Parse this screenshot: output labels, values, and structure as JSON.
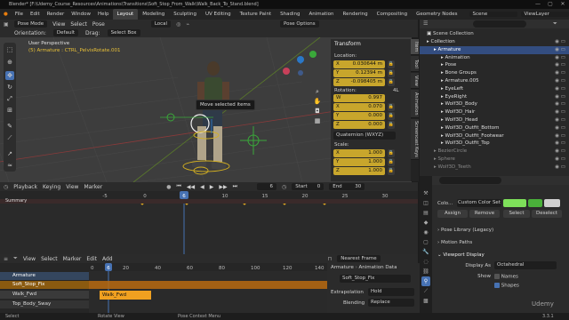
{
  "titlebar": {
    "text": "Blender* [F:\\Udemy_Course_Resources\\Animations\\Transitions\\Soft_Stop_From_Walk\\Walk_Back_To_Stand.blend]",
    "min": "—",
    "max": "▢",
    "close": "✕"
  },
  "menu": {
    "file": "File",
    "edit": "Edit",
    "render": "Render",
    "window": "Window",
    "help": "Help"
  },
  "workspaces": [
    "Layout",
    "Modeling",
    "Sculpting",
    "UV Editing",
    "Texture Paint",
    "Shading",
    "Animation",
    "Rendering",
    "Compositing",
    "Geometry Nodes"
  ],
  "scene": "Scene",
  "viewlayer": "ViewLayer",
  "viewport_header": {
    "mode": "Pose Mode",
    "view": "View",
    "select": "Select",
    "pose": "Pose",
    "orient_global": "Local",
    "orientation_label": "Orientation:",
    "orientation": "Default",
    "drag_label": "Drag:",
    "drag": "Select Box",
    "pose_options": "Pose Options"
  },
  "viewport": {
    "perspective": "User Perspective",
    "active": "(5) Armature : CTRL_PelvisRotate.001",
    "tooltip": "Move selected items"
  },
  "transform": {
    "title": "Transform",
    "location_label": "Location:",
    "loc": [
      "X",
      "Y",
      "Z"
    ],
    "loc_vals": [
      "0.030644 m",
      "0.12394 m",
      "-0.098405 m"
    ],
    "rotation_label": "Rotation:",
    "rot_mode": "4L",
    "rot": [
      "W",
      "X",
      "Y",
      "Z"
    ],
    "rot_vals": [
      "0.997",
      "0.070",
      "0.000",
      "0.000"
    ],
    "rot_type": "Quaternion (WXYZ)",
    "scale_label": "Scale:",
    "scale": [
      "X",
      "Y",
      "Z"
    ],
    "scale_vals": [
      "1.000",
      "1.000",
      "1.000"
    ]
  },
  "side_tabs": [
    "Item",
    "Tool",
    "View",
    "Animation",
    "Screencast Keys"
  ],
  "outliner": {
    "title": "Scene Collection",
    "rows": [
      {
        "label": "Collection",
        "indent": 1,
        "color": "#ddd"
      },
      {
        "label": "Armature",
        "indent": 2,
        "color": "#fff",
        "selected": true
      },
      {
        "label": "Animation",
        "indent": 3,
        "color": "#ddd"
      },
      {
        "label": "Pose",
        "indent": 3,
        "color": "#ddd"
      },
      {
        "label": "Bone Groups",
        "indent": 3,
        "color": "#ddd"
      },
      {
        "label": "Armature.005",
        "indent": 3,
        "color": "#ddd"
      },
      {
        "label": "EyeLeft",
        "indent": 3,
        "color": "#ddd"
      },
      {
        "label": "EyeRight",
        "indent": 3,
        "color": "#ddd"
      },
      {
        "label": "Wolf3D_Body",
        "indent": 3,
        "color": "#ddd"
      },
      {
        "label": "Wolf3D_Hair",
        "indent": 3,
        "color": "#ddd"
      },
      {
        "label": "Wolf3D_Head",
        "indent": 3,
        "color": "#ddd"
      },
      {
        "label": "Wolf3D_Outfit_Bottom",
        "indent": 3,
        "color": "#ddd"
      },
      {
        "label": "Wolf3D_Outfit_Footwear",
        "indent": 3,
        "color": "#ddd"
      },
      {
        "label": "Wolf3D_Outfit_Top",
        "indent": 3,
        "color": "#ddd"
      },
      {
        "label": "BezierCircle",
        "indent": 2,
        "color": "#888"
      },
      {
        "label": "Sphere",
        "indent": 2,
        "color": "#888"
      },
      {
        "label": "Wolf3D_Teeth",
        "indent": 2,
        "color": "#888"
      }
    ]
  },
  "playback": {
    "playback": "Playback",
    "keying": "Keying",
    "view": "View",
    "marker": "Marker",
    "current": "6",
    "start_label": "Start",
    "start": "0",
    "end_label": "End",
    "end": "30"
  },
  "dope": {
    "mode": "Dope Sheet",
    "ruler": [
      "-5",
      "0",
      "5",
      "10",
      "15",
      "20",
      "25",
      "30",
      "35"
    ],
    "current": "6",
    "summary": "Summary"
  },
  "nla": {
    "view": "View",
    "select": "Select",
    "marker": "Marker",
    "edit": "Edit",
    "add": "Add",
    "snap": "Nearest Frame",
    "ruler": [
      "0",
      "20",
      "40",
      "60",
      "80",
      "100",
      "120",
      "140"
    ],
    "current": "6",
    "tracks": [
      "Armature",
      "Soft_Stop_Fix",
      "Walk_Fwd",
      "Top_Body_Sway"
    ],
    "strip": "Walk_Fwd"
  },
  "nla_side": {
    "armature": "Armature",
    "anim_data": "Animation Data",
    "action": "Soft_Stop_Fix",
    "extrapolation_label": "Extrapolation",
    "extrapolation": "Hold",
    "blending_label": "Blending",
    "blending": "Replace"
  },
  "props": {
    "color_label": "Colo...",
    "color_set": "Custom Color Set",
    "assign": "Assign",
    "remove": "Remove",
    "select": "Select",
    "deselect": "Deselect",
    "pose_library": "Pose Library (Legacy)",
    "motion_paths": "Motion Paths",
    "viewport_display": "Viewport Display",
    "display_as_label": "Display As",
    "display_as": "Octahedral",
    "show_label": "Show",
    "names": "Names",
    "shapes": "Shapes"
  },
  "status": {
    "select": "Select",
    "rotate": "Rotate View",
    "context": "Pose Context Menu",
    "version": "3.3.1"
  },
  "watermark": "Udemy"
}
